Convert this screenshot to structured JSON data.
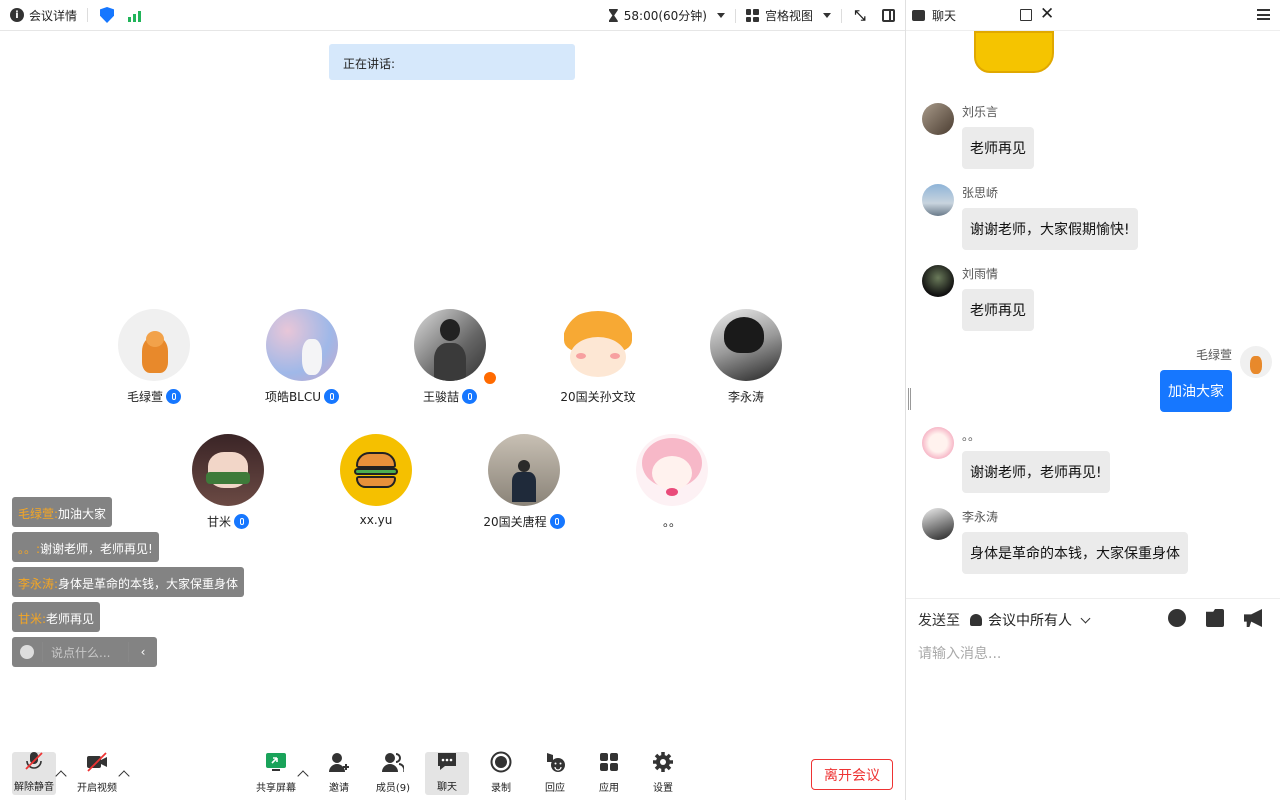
{
  "topbar": {
    "meeting_info": "会议详情",
    "timer": "58:00(60分钟)",
    "view": "宫格视图"
  },
  "speaking": {
    "label": "正在讲话:"
  },
  "participants": [
    {
      "name": "毛绿萱",
      "mic": true,
      "avatar": "tiger-toy"
    },
    {
      "name": "项皓BLCU",
      "mic": true,
      "avatar": "cherry-blossom"
    },
    {
      "name": "王骏喆",
      "mic": true,
      "host": true,
      "avatar": "bw-photo"
    },
    {
      "name": "20国关孙文玟",
      "mic": false,
      "avatar": "tiger-cartoon"
    },
    {
      "name": "李永涛",
      "mic": false,
      "avatar": "anime-bw"
    },
    {
      "name": "甘米",
      "mic": true,
      "avatar": "anime-girl"
    },
    {
      "name": "xx.yu",
      "mic": false,
      "avatar": "burger"
    },
    {
      "name": "20国关唐程",
      "mic": true,
      "avatar": "person-photo"
    },
    {
      "name": "。。",
      "mic": false,
      "avatar": "pink-anime"
    }
  ],
  "danmaku": [
    {
      "sender": "毛绿萱:",
      "text": "加油大家"
    },
    {
      "sender": "。。:",
      "text": "谢谢老师，老师再见!"
    },
    {
      "sender": "李永涛:",
      "text": "身体是革命的本钱，大家保重身体"
    },
    {
      "sender": "甘米:",
      "text": "老师再见"
    }
  ],
  "say_placeholder": "说点什么...",
  "toolbar": {
    "unmute": "解除静音",
    "video": "开启视频",
    "share": "共享屏幕",
    "invite": "邀请",
    "members": "成员(9)",
    "chat": "聊天",
    "record": "录制",
    "react": "回应",
    "apps": "应用",
    "settings": "设置",
    "leave": "离开会议"
  },
  "chat": {
    "title": "聊天",
    "messages": [
      {
        "name": "刘乐言",
        "text": "老师再见",
        "mine": false
      },
      {
        "name": "张思峤",
        "text": "谢谢老师，大家假期愉快!",
        "mine": false
      },
      {
        "name": "刘雨情",
        "text": "老师再见",
        "mine": false
      },
      {
        "name": "毛绿萱",
        "text": "加油大家",
        "mine": true
      },
      {
        "name": "。。",
        "text": "谢谢老师，老师再见!",
        "mine": false
      },
      {
        "name": "李永涛",
        "text": "身体是革命的本钱，大家保重身体",
        "mine": false
      }
    ],
    "send_to_label": "发送至",
    "send_to_target": "会议中所有人",
    "input_placeholder": "请输入消息..."
  },
  "colors": {
    "accent": "#1677ff",
    "leave": "#e33333",
    "highlight": "#f5a623"
  }
}
